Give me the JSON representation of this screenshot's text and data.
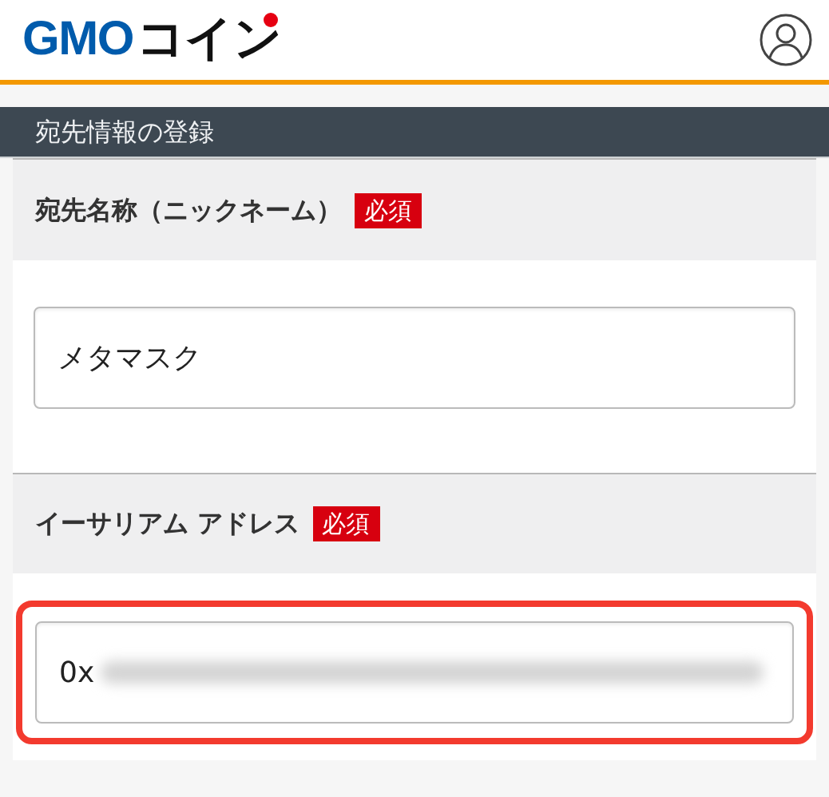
{
  "header": {
    "logo": {
      "brand": "GMO",
      "suffix": "コイン"
    }
  },
  "section": {
    "title": "宛先情報の登録"
  },
  "fields": [
    {
      "label": "宛先名称（ニックネーム）",
      "badge": "必須",
      "value": "メタマスク",
      "redacted": false,
      "highlighted": false
    },
    {
      "label": "イーサリアム アドレス",
      "badge": "必須",
      "value": "0x",
      "redacted": true,
      "highlighted": true
    }
  ]
}
